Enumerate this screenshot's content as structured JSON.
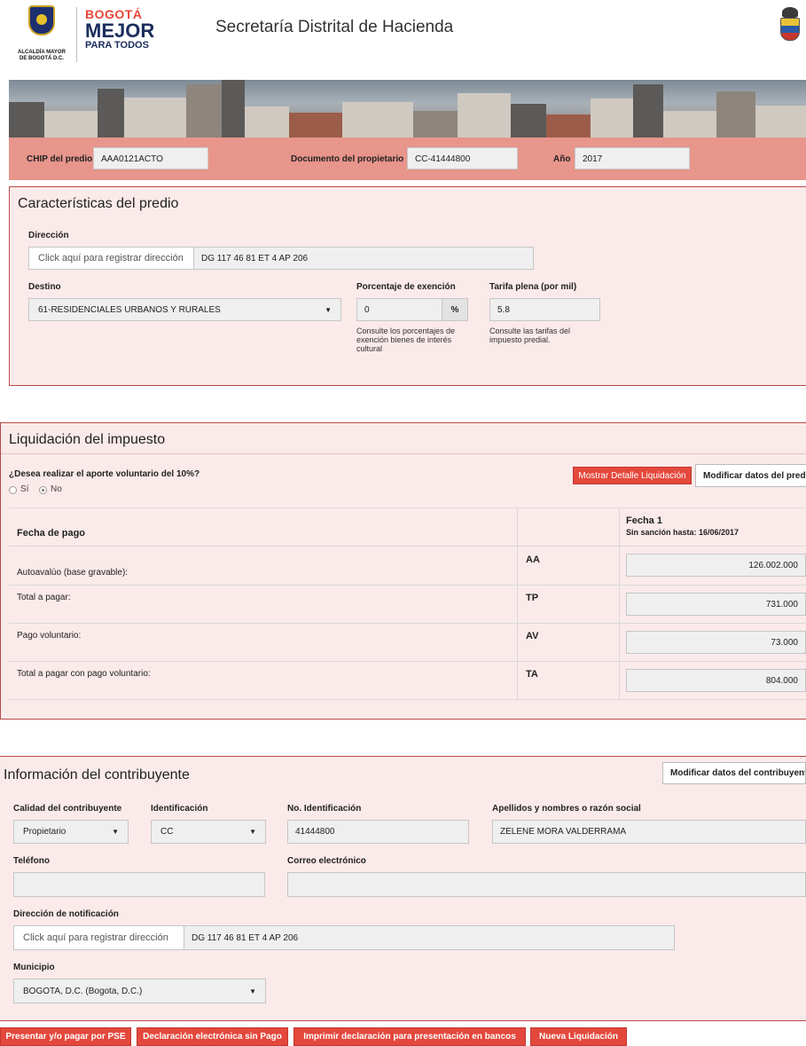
{
  "header": {
    "crest_text": "ALCALDÍA MAYOR\nDE BOGOTÁ D.C.",
    "logo_line1": "BOGOTÁ",
    "logo_line2": "MEJOR",
    "logo_line3": "PARA TODOS",
    "title": "Secretaría Distrital de Hacienda"
  },
  "search": {
    "chip_label": "CHIP del predio",
    "chip_value": "AAA0121ACTO",
    "doc_label": "Documento del propietario",
    "doc_value": "CC-41444800",
    "year_label": "Año",
    "year_value": "2017"
  },
  "predio": {
    "title": "Características del predio",
    "address_label": "Dirección",
    "address_button": "Click aquí para registrar dirección",
    "address_value": "DG 117 46 81 ET 4 AP 206",
    "destino_label": "Destino",
    "destino_value": "61-RESIDENCIALES URBANOS Y RURALES",
    "exencion_label": "Porcentaje de exención",
    "exencion_value": "0",
    "exencion_addon": "%",
    "exencion_help": "Consulte los porcentajes de exención bienes de interés cultural",
    "tarifa_label": "Tarifa plena (por mil)",
    "tarifa_value": "5.8",
    "tarifa_help": "Consulte las tarifas del impuesto predial."
  },
  "liquidacion": {
    "title": "Liquidación del impuesto",
    "question": "¿Desea realizar el aporte voluntario del 10%?",
    "option_si": "Sí",
    "option_no": "No",
    "selected": "No",
    "btn_detalle": "Mostrar Detalle Liquidación",
    "btn_modificar": "Modificar datos del predio",
    "col_fecha": "Fecha de pago",
    "fecha_title": "Fecha 1",
    "fecha_sub": "Sin sanción hasta: 16/06/2017",
    "rows": [
      {
        "label": "Autoavalúo (base gravable):",
        "code": "AA",
        "value": "126.002.000"
      },
      {
        "label": "Total a pagar:",
        "code": "TP",
        "value": "731.000"
      },
      {
        "label": "Pago voluntario:",
        "code": "AV",
        "value": "73.000"
      },
      {
        "label": "Total a pagar con pago voluntario:",
        "code": "TA",
        "value": "804.000"
      }
    ]
  },
  "contribuyente": {
    "title": "Información del contribuyente",
    "btn_modificar": "Modificar datos del contribuyente",
    "calidad_label": "Calidad del contribuyente",
    "calidad_value": "Propietario",
    "ident_label": "Identificación",
    "ident_value": "CC",
    "numero_label": "No. Identificación",
    "numero_value": "41444800",
    "nombre_label": "Apellidos y nombres o razón social",
    "nombre_value": "ZELENE  MORA VALDERRAMA",
    "telefono_label": "Teléfono",
    "telefono_value": "",
    "correo_label": "Correo electrónico",
    "correo_value": "",
    "notif_label": "Dirección de notificación",
    "notif_button": "Click aquí para registrar dirección",
    "notif_value": "DG 117 46 81 ET 4 AP 206",
    "municipio_label": "Municipio",
    "municipio_value": "BOGOTA, D.C. (Bogota, D.C.)"
  },
  "actions": {
    "pse": "Presentar y/o pagar por PSE",
    "sin_pago": "Declaración electrónica sin Pago",
    "imprimir": "Imprimir declaración para presentación en bancos",
    "nueva": "Nueva Liquidación"
  },
  "colors": {
    "accent_red": "#e4483c",
    "bar_salmon": "#e8958b",
    "panel_bg": "#fbeaea",
    "border_red": "#b94a48"
  }
}
